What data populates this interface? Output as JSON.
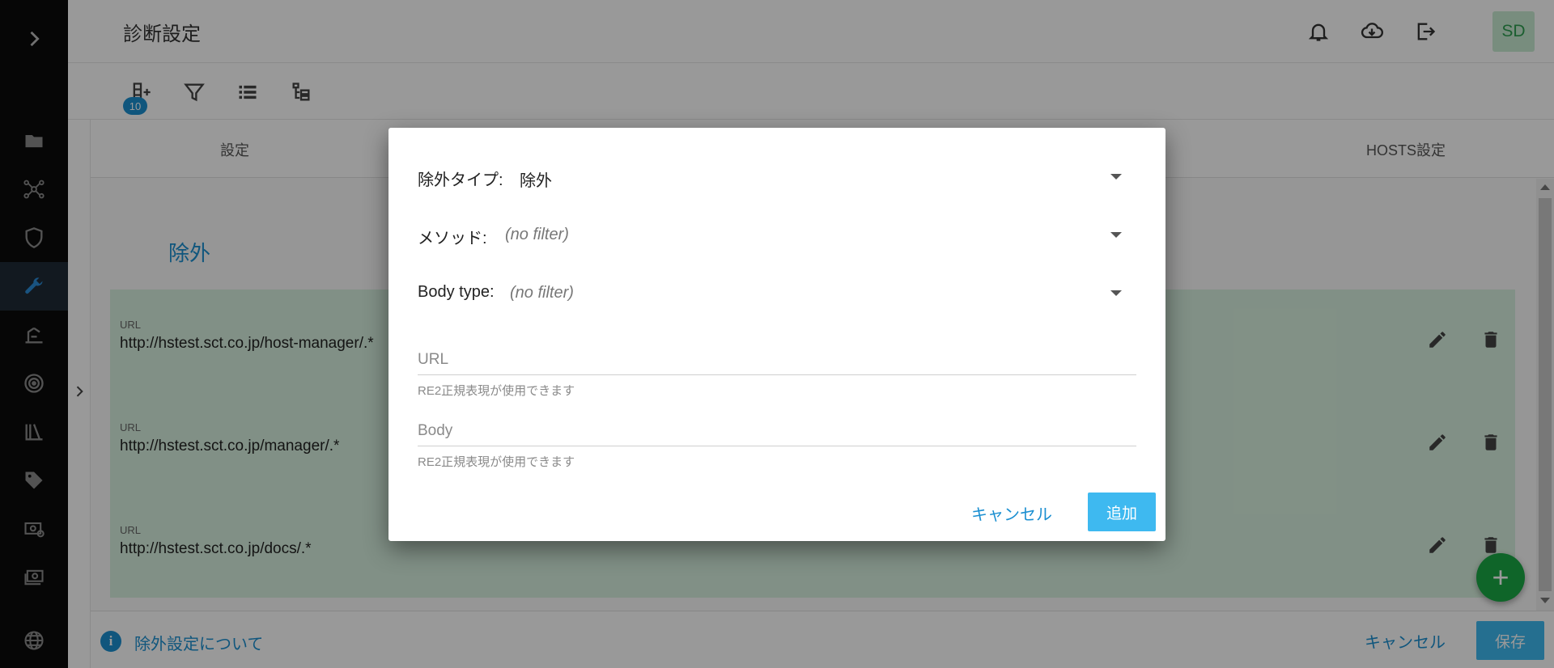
{
  "header": {
    "title": "診断設定",
    "avatar": "SD"
  },
  "toolbar": {
    "badge_count": "10"
  },
  "tabs": [
    "設定",
    "HOSTS設定"
  ],
  "section": {
    "title": "除外"
  },
  "rows": [
    {
      "label": "URL",
      "value": "http://hstest.sct.co.jp/host-manager/.*"
    },
    {
      "label": "URL",
      "value": "http://hstest.sct.co.jp/manager/.*"
    },
    {
      "label": "URL",
      "value": "http://hstest.sct.co.jp/docs/.*"
    }
  ],
  "bottombar": {
    "info_link": "除外設定について",
    "cancel_label": "キャンセル",
    "save_label": "保存"
  },
  "dialog": {
    "exclusion_type": {
      "label": "除外タイプ:",
      "value": "除外"
    },
    "method": {
      "label": "メソッド:",
      "value": "(no filter)"
    },
    "body_type": {
      "label": "Body type:",
      "value": "(no filter)"
    },
    "url_field": {
      "placeholder": "URL",
      "value": "",
      "hint": "RE2正規表現が使用できます"
    },
    "body_field": {
      "placeholder": "Body",
      "value": "",
      "hint": "RE2正規表現が使用できます"
    },
    "cancel_label": "キャンセル",
    "add_label": "追加"
  },
  "icons": {
    "rail": [
      "chevron-right-icon",
      "folder-icon",
      "network-icon",
      "shield-icon",
      "wrench-icon",
      "scan-icon",
      "target-icon",
      "library-icon",
      "tag-icon",
      "license-icon",
      "billing-icon",
      "globe-icon"
    ],
    "header": [
      "bell-icon",
      "cloud-download-icon",
      "logout-icon"
    ],
    "toolbar": [
      "add-list-icon",
      "filter-icon",
      "list-view-icon",
      "tree-view-icon"
    ]
  },
  "colors": {
    "accent": "#1b8fd1",
    "primary_button": "#3eb9f0",
    "row_bg": "#d8f1df",
    "fab": "#1aa845",
    "rail_bg": "#0b0b0b",
    "rail_active": "#2a8bd6"
  }
}
